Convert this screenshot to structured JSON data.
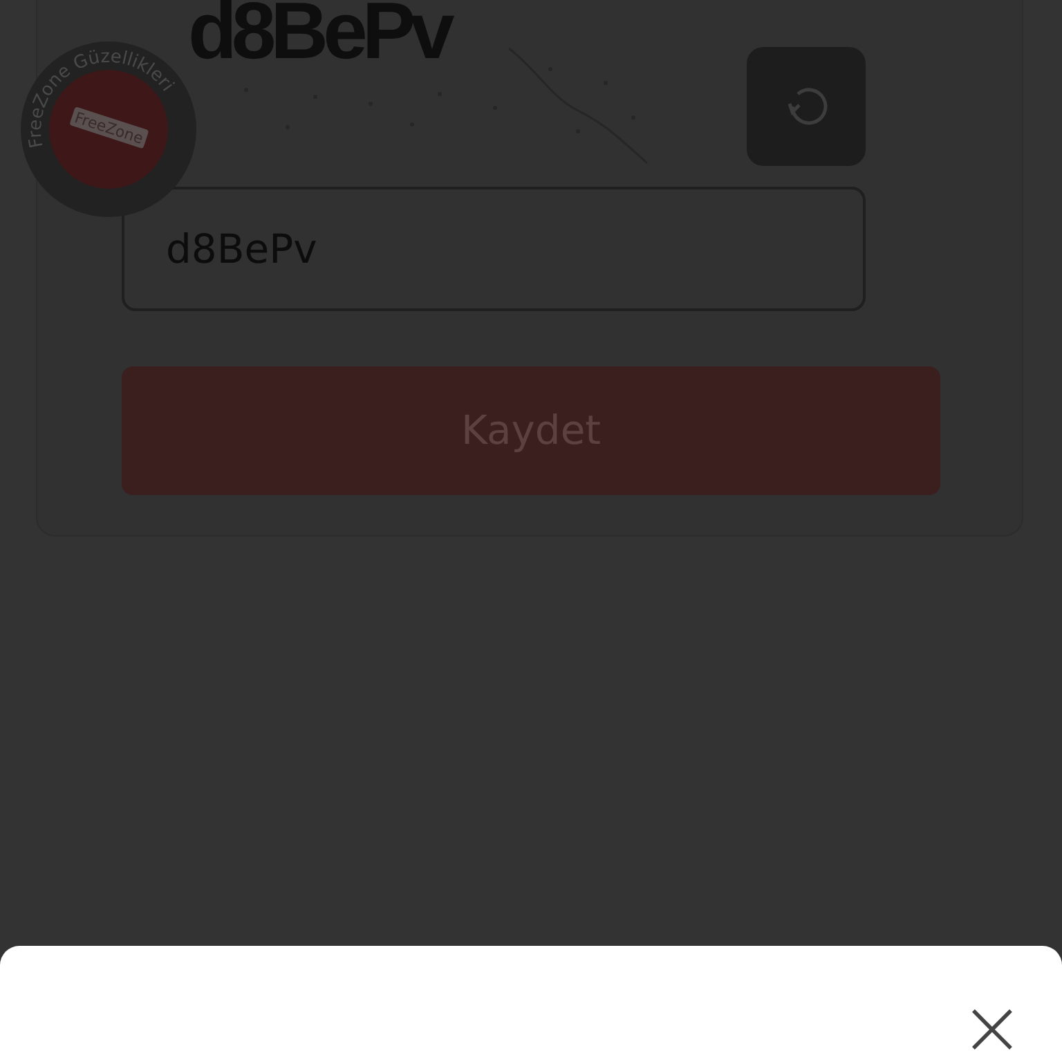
{
  "badge": {
    "ring_text": "FreeZone Güzellikleri",
    "center_text": "FreeZone"
  },
  "captcha": {
    "text": "d8BePv"
  },
  "code_field": {
    "value": "d8BePv"
  },
  "save_button": {
    "label": "Kaydet"
  },
  "bottom_sheet": {
    "close": "×"
  }
}
